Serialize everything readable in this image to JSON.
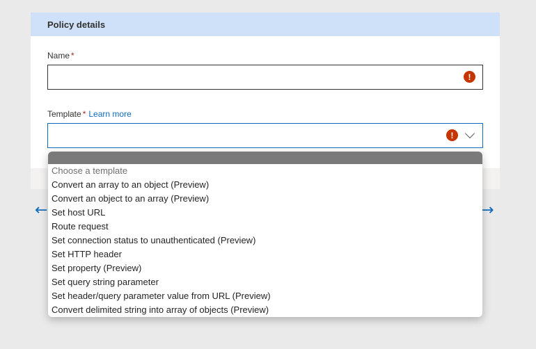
{
  "panel": {
    "title": "Policy details"
  },
  "form": {
    "name_label": "Name",
    "required_mark": "*",
    "template_label": "Template",
    "learn_more": "Learn more",
    "error_glyph": "!"
  },
  "dropdown": {
    "placeholder": "Choose a template",
    "options": [
      "Convert an array to an object (Preview)",
      "Convert an object to an array (Preview)",
      "Set host URL",
      "Route request",
      "Set connection status to unauthenticated (Preview)",
      "Set HTTP header",
      "Set property (Preview)",
      "Set query string parameter",
      "Set header/query parameter value from URL (Preview)",
      "Convert delimited string into array of objects (Preview)"
    ]
  },
  "icons": {
    "error": "error-icon",
    "chevron": "chevron-down-icon",
    "back": "arrow-left-icon",
    "forward": "arrow-right-icon"
  },
  "colors": {
    "header_bg": "#cfe0f9",
    "accent": "#0f6cbd",
    "error": "#c43501"
  }
}
